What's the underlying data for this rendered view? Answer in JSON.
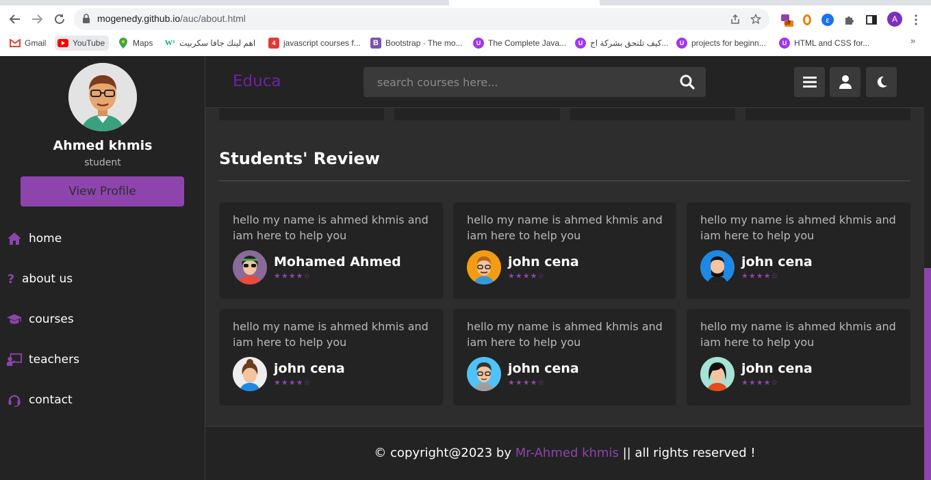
{
  "browser": {
    "url_host": "mogenedy.github.io",
    "url_path": "/auc/about.html",
    "profile_initial": "A",
    "ext_badge": "off",
    "bookmarks": [
      {
        "label": "Gmail",
        "icon": "gmail-icon"
      },
      {
        "label": "YouTube",
        "icon": "youtube-icon"
      },
      {
        "label": "Maps",
        "icon": "maps-icon"
      },
      {
        "label": "اهم لينك جافا سكربيت",
        "icon": "w3-icon"
      },
      {
        "label": "javascript courses f...",
        "icon": "js-icon"
      },
      {
        "label": "Bootstrap · The mo...",
        "icon": "bootstrap-icon"
      },
      {
        "label": "The Complete Java...",
        "icon": "udemy-icon"
      },
      {
        "label": "كيف تلتحق بشركة اج...",
        "icon": "udemy-icon"
      },
      {
        "label": "projects for beginn...",
        "icon": "udemy-icon"
      },
      {
        "label": "HTML and CSS for...",
        "icon": "udemy-icon"
      }
    ],
    "more": "»"
  },
  "sidebar": {
    "name": "Ahmed khmis",
    "role": "student",
    "view_profile": "View Profile",
    "items": [
      {
        "label": "home",
        "icon": "home-icon"
      },
      {
        "label": "about us",
        "icon": "question-icon"
      },
      {
        "label": "courses",
        "icon": "graduation-cap-icon"
      },
      {
        "label": "teachers",
        "icon": "chalkboard-teacher-icon"
      },
      {
        "label": "contact",
        "icon": "headset-icon"
      }
    ]
  },
  "header": {
    "logo": "Educa",
    "search_placeholder": "search courses here..."
  },
  "main": {
    "section_title": "Students' Review",
    "reviews": [
      {
        "text": "hello my name is ahmed khmis and iam here to help you",
        "name": "Mohamed Ahmed",
        "rating": 4.5
      },
      {
        "text": "hello my name is ahmed khmis and iam here to help you",
        "name": "john cena",
        "rating": 4.5
      },
      {
        "text": "hello my name is ahmed khmis and iam here to help you",
        "name": "john cena",
        "rating": 4.5
      },
      {
        "text": "hello my name is ahmed khmis and iam here to help you",
        "name": "john cena",
        "rating": 4.5
      },
      {
        "text": "hello my name is ahmed khmis and iam here to help you",
        "name": "john cena",
        "rating": 4.5
      },
      {
        "text": "hello my name is ahmed khmis and iam here to help you",
        "name": "john cena",
        "rating": 4.5
      }
    ]
  },
  "footer": {
    "prefix": "© copyright@2023 by ",
    "author": "Mr-Ahmed khmis",
    "suffix": " || all rights reserved !"
  },
  "colors": {
    "accent": "#8e44ad",
    "logo": "#6c22a6",
    "panel": "#232323",
    "background": "#2d2d2d"
  }
}
